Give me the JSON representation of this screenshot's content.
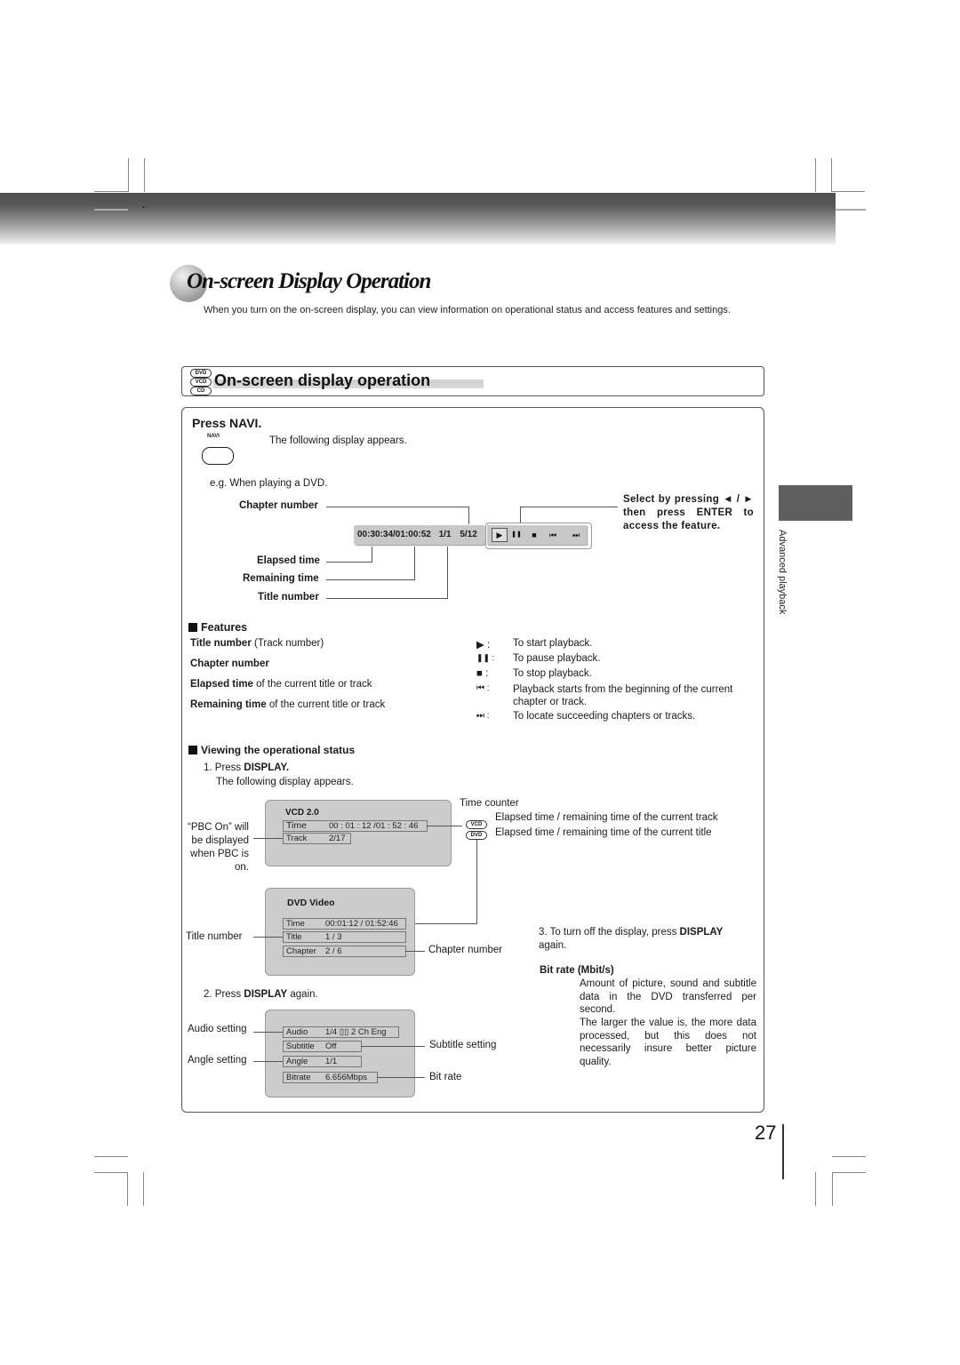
{
  "header": {
    "bullet": "."
  },
  "page_title": "On-screen Display Operation",
  "intro_text": "When you turn on the on-screen display, you can view information on operational status and access features and settings.",
  "section": {
    "disc_badges": [
      "DVD",
      "VCD",
      "CD"
    ],
    "title": "On-screen display operation"
  },
  "press_navi": {
    "heading": "Press NAVI.",
    "button_label": "NAVI",
    "result_text": "The following display appears.",
    "example_text": "e.g. When playing a DVD."
  },
  "navi_bar": {
    "time_readout": "00:30:34/01:00:52",
    "title_value": "1/1",
    "chapter_value": "5/12",
    "controls": [
      {
        "icon": "play-icon",
        "glyph": "▶"
      },
      {
        "icon": "pause-icon",
        "glyph": "❚❚"
      },
      {
        "icon": "stop-icon",
        "glyph": "■"
      },
      {
        "icon": "skip-back-icon",
        "glyph": "⏮"
      },
      {
        "icon": "skip-forward-icon",
        "glyph": "⏭"
      }
    ],
    "callouts": {
      "chapter_number": "Chapter number",
      "elapsed_time": "Elapsed time",
      "remaining_time": "Remaining time",
      "title_number": "Title number",
      "select_hint": "Select by pressing ◄ / ► then press ENTER to access the feature."
    }
  },
  "features": {
    "heading": "Features",
    "left": [
      {
        "bold": "Title number",
        "rest": " (Track number)"
      },
      {
        "bold": "Chapter number",
        "rest": ""
      },
      {
        "bold": "Elapsed time",
        "rest": " of the current title or track"
      },
      {
        "bold": "Remaining time",
        "rest": " of the current title or track"
      }
    ],
    "right": [
      {
        "icon": "play-icon",
        "glyph": "▶",
        "text": "To start playback."
      },
      {
        "icon": "pause-icon",
        "glyph": "❚❚",
        "text": "To pause playback."
      },
      {
        "icon": "stop-icon",
        "glyph": "■",
        "text": "To stop playback."
      },
      {
        "icon": "skip-back-icon",
        "glyph": "⏮",
        "text": "Playback starts from the beginning of the current chapter or track."
      },
      {
        "icon": "skip-forward-icon",
        "glyph": "⏭",
        "text": "To locate succeeding chapters or tracks."
      }
    ]
  },
  "viewing": {
    "heading": "Viewing the operational status",
    "step1_prefix": "1. Press ",
    "step1_bold": "DISPLAY.",
    "step1_result": "The following display appears.",
    "pbc_note": "“PBC On” will be displayed when PBC is on.",
    "time_counter_label": "Time counter",
    "time_counter_vcd_badge": "VCD",
    "time_counter_vcd": "Elapsed time / remaining time of the current track",
    "time_counter_dvd_badge": "DVD",
    "time_counter_dvd": "Elapsed time / remaining time of the current title",
    "vcd_osd": {
      "title": "VCD 2.0",
      "rows": [
        {
          "label": "Time",
          "value": "00 : 01 : 12 /01 : 52 : 46"
        },
        {
          "label": "Track",
          "value": "2/17"
        }
      ]
    },
    "dvd_osd": {
      "title": "DVD Video",
      "rows": [
        {
          "label": "Time",
          "value": "00:01:12 / 01:52:46"
        },
        {
          "label": "Title",
          "value": "1 / 3"
        },
        {
          "label": "Chapter",
          "value": "2 / 6"
        }
      ],
      "title_number_label": "Title number",
      "chapter_number_label": "Chapter number"
    },
    "step2_prefix": "2. Press ",
    "step2_bold": "DISPLAY",
    "step2_suffix": " again.",
    "settings_osd": {
      "rows": [
        {
          "label": "Audio",
          "value": "1/4 ▯▯ 2 Ch  Eng"
        },
        {
          "label": "Subtitle",
          "value": "Off"
        },
        {
          "label": "Angle",
          "value": "1/1"
        },
        {
          "label": "Bitrate",
          "value": "6.656Mbps"
        }
      ],
      "audio_label": "Audio setting",
      "angle_label": "Angle setting",
      "subtitle_label": "Subtitle setting",
      "bitrate_label": "Bit rate"
    },
    "step3_prefix": "3. To turn off the display, press ",
    "step3_bold": "DISPLAY",
    "step3_suffix": " again.",
    "bitrate_heading": "Bit rate (Mbit/s)",
    "bitrate_desc1": "Amount of picture, sound and subtitle data in the DVD transferred per second.",
    "bitrate_desc2": "The larger the value is, the more data processed, but this does not necessarily insure better picture quality."
  },
  "side_tab_label": "Advanced playback",
  "page_number": "27"
}
